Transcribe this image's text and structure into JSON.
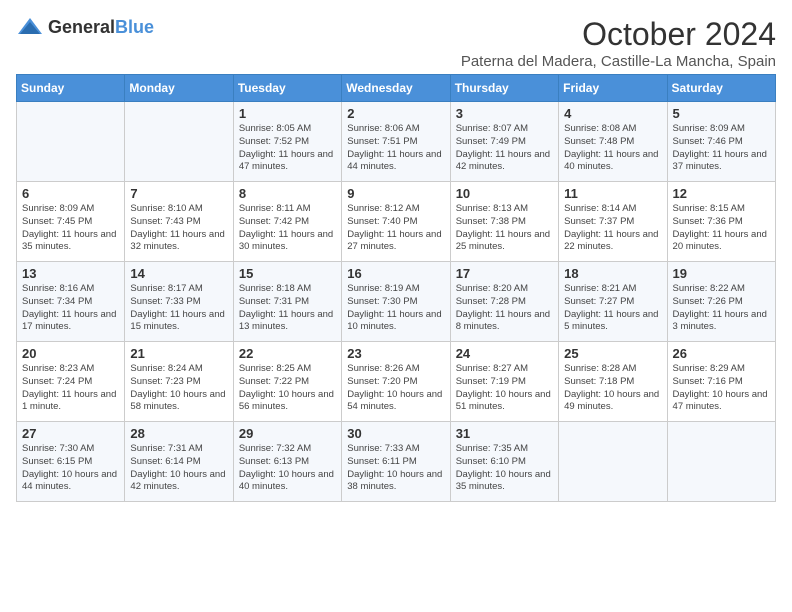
{
  "header": {
    "logo_general": "General",
    "logo_blue": "Blue",
    "month_year": "October 2024",
    "location": "Paterna del Madera, Castille-La Mancha, Spain"
  },
  "days_of_week": [
    "Sunday",
    "Monday",
    "Tuesday",
    "Wednesday",
    "Thursday",
    "Friday",
    "Saturday"
  ],
  "weeks": [
    [
      {
        "day": "",
        "info": ""
      },
      {
        "day": "",
        "info": ""
      },
      {
        "day": "1",
        "info": "Sunrise: 8:05 AM\nSunset: 7:52 PM\nDaylight: 11 hours and 47 minutes."
      },
      {
        "day": "2",
        "info": "Sunrise: 8:06 AM\nSunset: 7:51 PM\nDaylight: 11 hours and 44 minutes."
      },
      {
        "day": "3",
        "info": "Sunrise: 8:07 AM\nSunset: 7:49 PM\nDaylight: 11 hours and 42 minutes."
      },
      {
        "day": "4",
        "info": "Sunrise: 8:08 AM\nSunset: 7:48 PM\nDaylight: 11 hours and 40 minutes."
      },
      {
        "day": "5",
        "info": "Sunrise: 8:09 AM\nSunset: 7:46 PM\nDaylight: 11 hours and 37 minutes."
      }
    ],
    [
      {
        "day": "6",
        "info": "Sunrise: 8:09 AM\nSunset: 7:45 PM\nDaylight: 11 hours and 35 minutes."
      },
      {
        "day": "7",
        "info": "Sunrise: 8:10 AM\nSunset: 7:43 PM\nDaylight: 11 hours and 32 minutes."
      },
      {
        "day": "8",
        "info": "Sunrise: 8:11 AM\nSunset: 7:42 PM\nDaylight: 11 hours and 30 minutes."
      },
      {
        "day": "9",
        "info": "Sunrise: 8:12 AM\nSunset: 7:40 PM\nDaylight: 11 hours and 27 minutes."
      },
      {
        "day": "10",
        "info": "Sunrise: 8:13 AM\nSunset: 7:38 PM\nDaylight: 11 hours and 25 minutes."
      },
      {
        "day": "11",
        "info": "Sunrise: 8:14 AM\nSunset: 7:37 PM\nDaylight: 11 hours and 22 minutes."
      },
      {
        "day": "12",
        "info": "Sunrise: 8:15 AM\nSunset: 7:36 PM\nDaylight: 11 hours and 20 minutes."
      }
    ],
    [
      {
        "day": "13",
        "info": "Sunrise: 8:16 AM\nSunset: 7:34 PM\nDaylight: 11 hours and 17 minutes."
      },
      {
        "day": "14",
        "info": "Sunrise: 8:17 AM\nSunset: 7:33 PM\nDaylight: 11 hours and 15 minutes."
      },
      {
        "day": "15",
        "info": "Sunrise: 8:18 AM\nSunset: 7:31 PM\nDaylight: 11 hours and 13 minutes."
      },
      {
        "day": "16",
        "info": "Sunrise: 8:19 AM\nSunset: 7:30 PM\nDaylight: 11 hours and 10 minutes."
      },
      {
        "day": "17",
        "info": "Sunrise: 8:20 AM\nSunset: 7:28 PM\nDaylight: 11 hours and 8 minutes."
      },
      {
        "day": "18",
        "info": "Sunrise: 8:21 AM\nSunset: 7:27 PM\nDaylight: 11 hours and 5 minutes."
      },
      {
        "day": "19",
        "info": "Sunrise: 8:22 AM\nSunset: 7:26 PM\nDaylight: 11 hours and 3 minutes."
      }
    ],
    [
      {
        "day": "20",
        "info": "Sunrise: 8:23 AM\nSunset: 7:24 PM\nDaylight: 11 hours and 1 minute."
      },
      {
        "day": "21",
        "info": "Sunrise: 8:24 AM\nSunset: 7:23 PM\nDaylight: 10 hours and 58 minutes."
      },
      {
        "day": "22",
        "info": "Sunrise: 8:25 AM\nSunset: 7:22 PM\nDaylight: 10 hours and 56 minutes."
      },
      {
        "day": "23",
        "info": "Sunrise: 8:26 AM\nSunset: 7:20 PM\nDaylight: 10 hours and 54 minutes."
      },
      {
        "day": "24",
        "info": "Sunrise: 8:27 AM\nSunset: 7:19 PM\nDaylight: 10 hours and 51 minutes."
      },
      {
        "day": "25",
        "info": "Sunrise: 8:28 AM\nSunset: 7:18 PM\nDaylight: 10 hours and 49 minutes."
      },
      {
        "day": "26",
        "info": "Sunrise: 8:29 AM\nSunset: 7:16 PM\nDaylight: 10 hours and 47 minutes."
      }
    ],
    [
      {
        "day": "27",
        "info": "Sunrise: 7:30 AM\nSunset: 6:15 PM\nDaylight: 10 hours and 44 minutes."
      },
      {
        "day": "28",
        "info": "Sunrise: 7:31 AM\nSunset: 6:14 PM\nDaylight: 10 hours and 42 minutes."
      },
      {
        "day": "29",
        "info": "Sunrise: 7:32 AM\nSunset: 6:13 PM\nDaylight: 10 hours and 40 minutes."
      },
      {
        "day": "30",
        "info": "Sunrise: 7:33 AM\nSunset: 6:11 PM\nDaylight: 10 hours and 38 minutes."
      },
      {
        "day": "31",
        "info": "Sunrise: 7:35 AM\nSunset: 6:10 PM\nDaylight: 10 hours and 35 minutes."
      },
      {
        "day": "",
        "info": ""
      },
      {
        "day": "",
        "info": ""
      }
    ]
  ]
}
